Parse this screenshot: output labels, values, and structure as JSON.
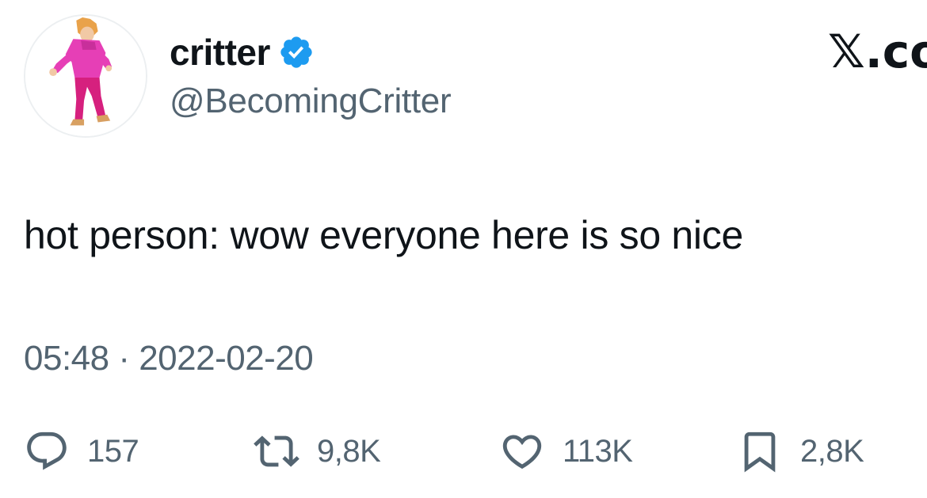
{
  "author": {
    "display_name": "critter",
    "handle": "@BecomingCritter",
    "verified": true
  },
  "brand": {
    "logo_text": "𝕏.com"
  },
  "tweet": {
    "text": "hot person: wow everyone here is so nice",
    "timestamp": "05:48 · 2022-02-20"
  },
  "actions": {
    "replies": "157",
    "reposts": "9,8K",
    "likes": "113K",
    "bookmarks": "2,8K"
  },
  "icons": {
    "reply": "speech-bubble-icon",
    "repost": "repost-arrows-icon",
    "like": "heart-icon",
    "bookmark": "bookmark-icon",
    "verified": "verified-badge-icon"
  },
  "colors": {
    "text_primary": "#0f1419",
    "text_secondary": "#536471",
    "verified_blue": "#1d9bf0",
    "avatar_outfit_pink": "#e63fb6"
  }
}
